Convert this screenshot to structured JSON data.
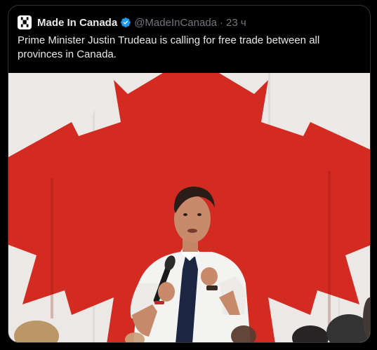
{
  "tweet": {
    "display_name": "Made In Canada",
    "avatar_text": "MADE IN CANADA",
    "verified": true,
    "handle": "@MadeInCanada",
    "separator": "·",
    "time": "23 ч",
    "text": "Prime Minister Justin Trudeau is calling for free trade between all provinces in Canada.",
    "media": {
      "description_icon": "photo",
      "colors": {
        "flag_red": "#d72a22",
        "flag_white": "#f1efee",
        "shirt": "#f5f5f3",
        "tie": "#1c2541",
        "skin": "#c88a6b",
        "hair": "#2a1d17"
      }
    }
  },
  "colors": {
    "background": "#000000",
    "border": "#2f3336",
    "text_primary": "#e7e9ea",
    "text_secondary": "#71767b",
    "verified_blue": "#1d9bf0"
  }
}
